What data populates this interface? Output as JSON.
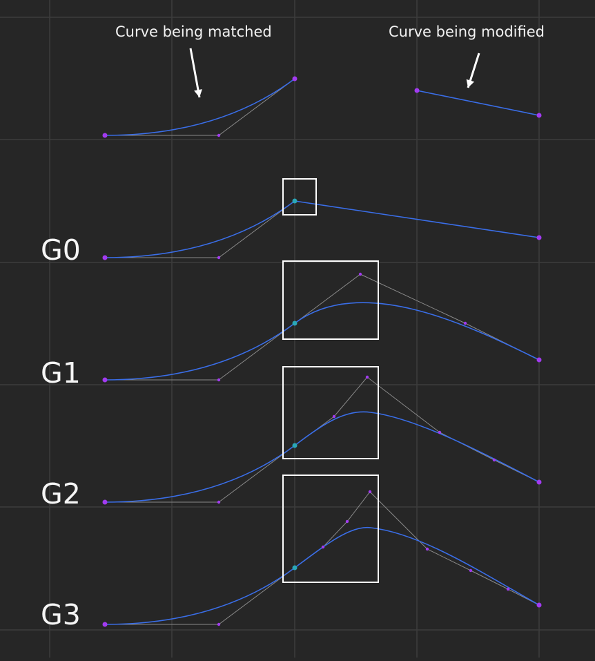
{
  "captions": {
    "matched": "Curve being matched",
    "modified": "Curve being modified"
  },
  "levels": [
    "G0",
    "G1",
    "G2",
    "G3"
  ],
  "colors": {
    "background": "#262626",
    "grid": "#3d3d3d",
    "curve": "#3a6ee8",
    "control_point": "#a23bf0",
    "joint_point": "#2aa7b8",
    "hull": "#8a8a8a",
    "frame": "#ffffff",
    "text": "#f2f2f2"
  }
}
